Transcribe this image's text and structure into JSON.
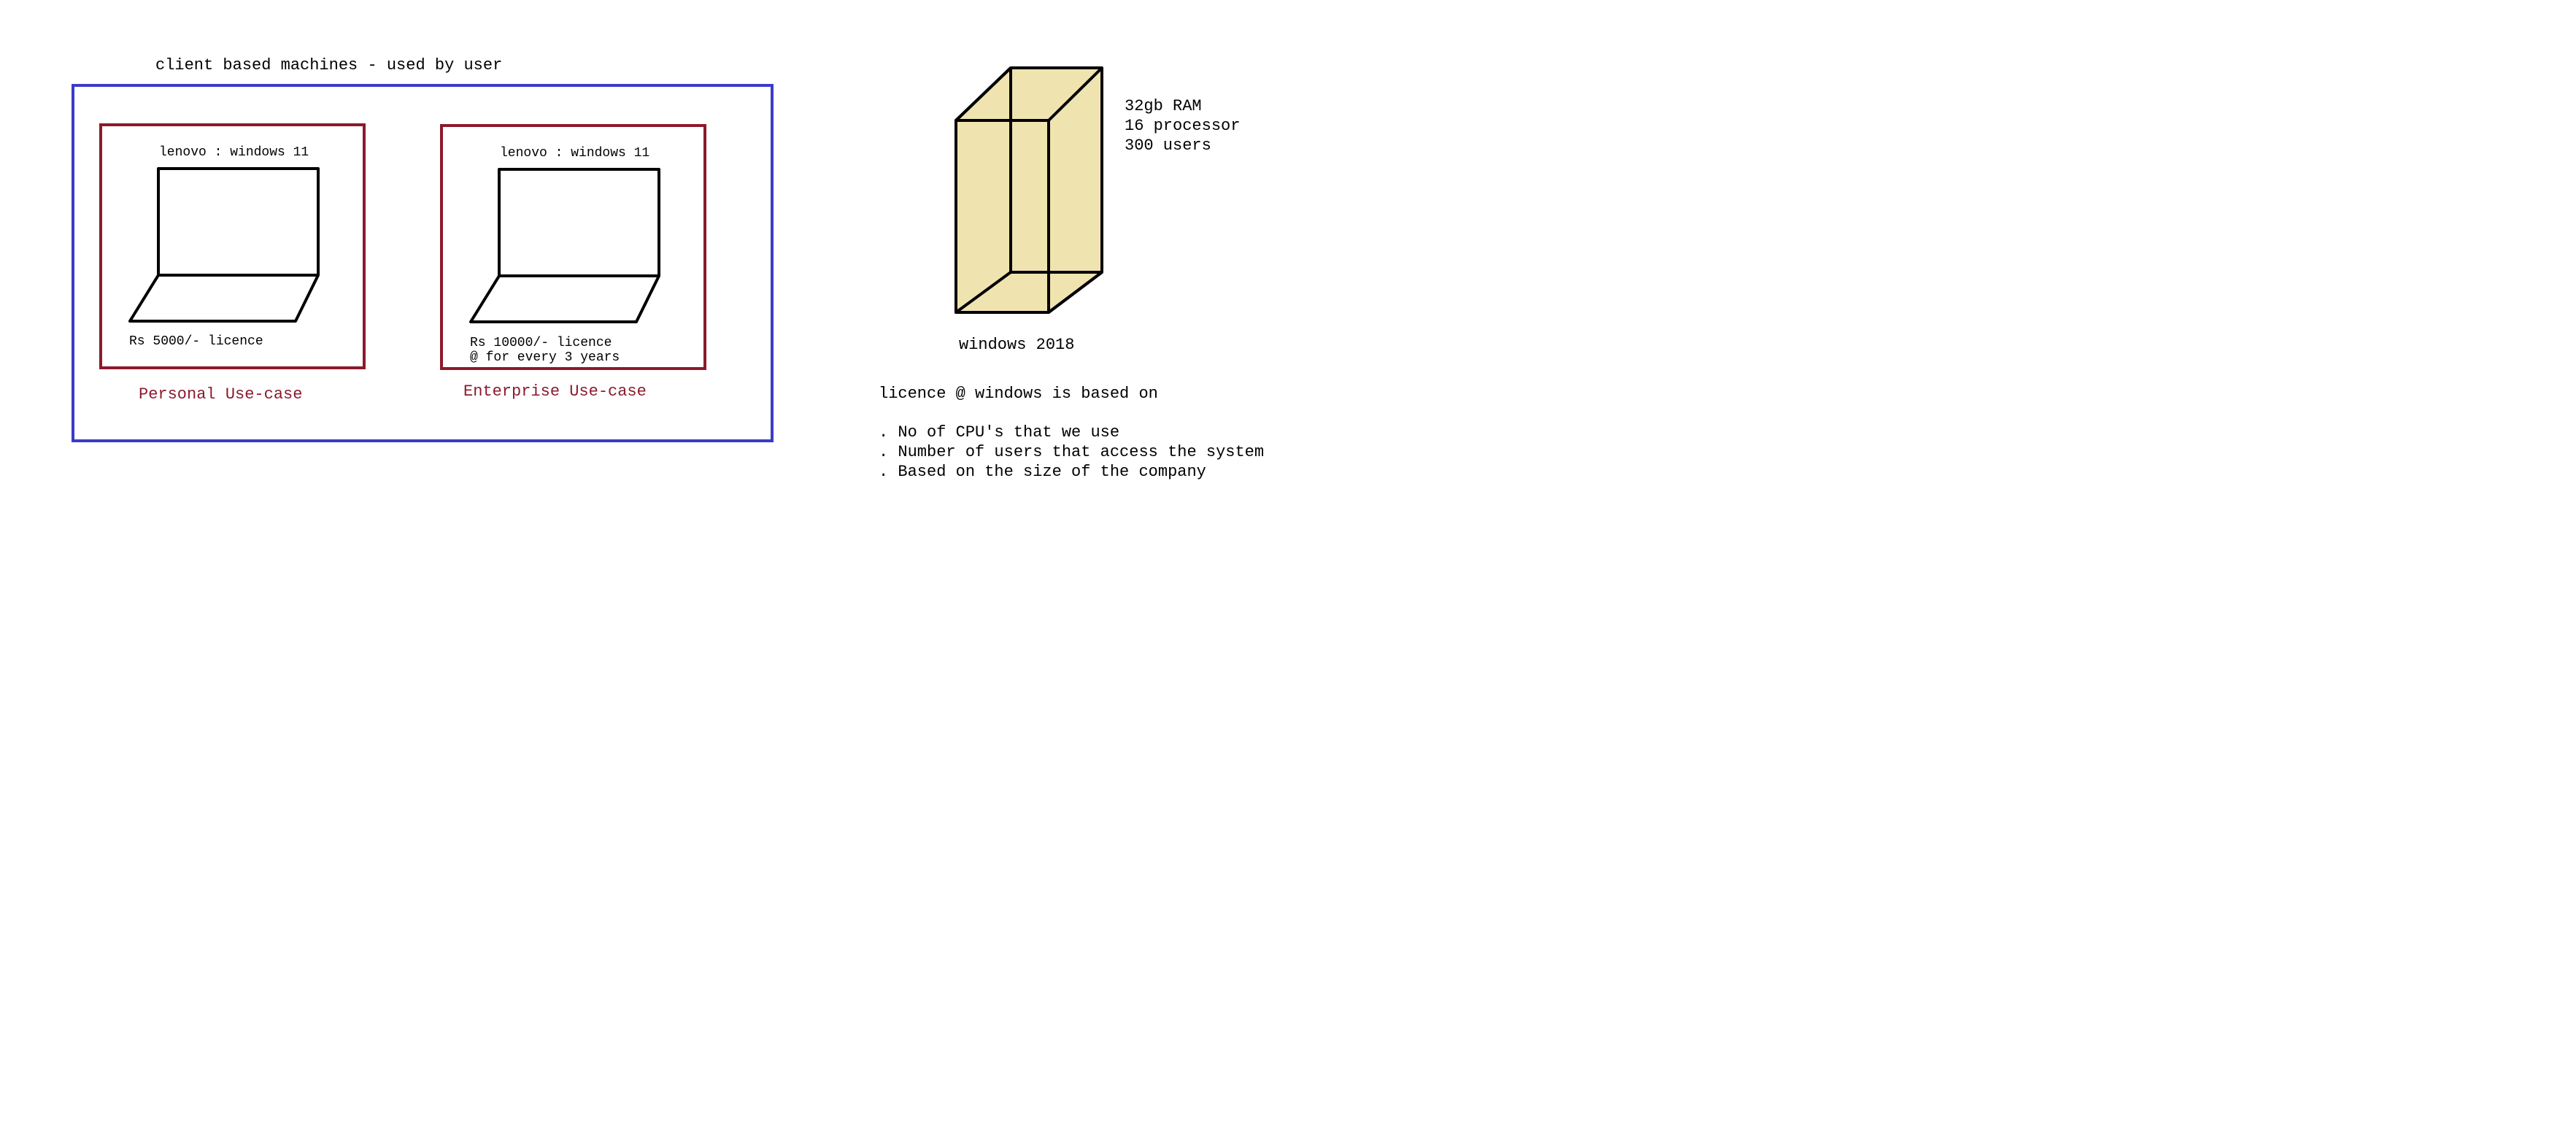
{
  "colors": {
    "outer_box": "#3b3bc9",
    "inner_box": "#8b1a2b",
    "use_case_text": "#8b1a2b",
    "server_fill": "#efe3b0",
    "ink": "#000000",
    "background": "#ffffff"
  },
  "client_group": {
    "title": "client based machines - used by user",
    "personal": {
      "device_label": "lenovo : windows 11",
      "licence_text": "Rs 5000/- licence",
      "use_case_label": "Personal Use-case",
      "icon": "laptop-icon"
    },
    "enterprise": {
      "device_label": "lenovo : windows 11",
      "licence_line1": "Rs 10000/- licence",
      "licence_line2": "@ for every 3 years",
      "use_case_label": "Enterprise Use-case",
      "icon": "laptop-icon"
    }
  },
  "server": {
    "icon": "server-tower-icon",
    "specs": [
      "32gb RAM",
      "16 processor",
      "300 users"
    ],
    "label": "windows 2018"
  },
  "licence_notes": {
    "heading": "licence @ windows is based on",
    "items": [
      ". No of CPU's that we use",
      ". Number of users that access the system",
      ". Based on the size of the company"
    ]
  }
}
